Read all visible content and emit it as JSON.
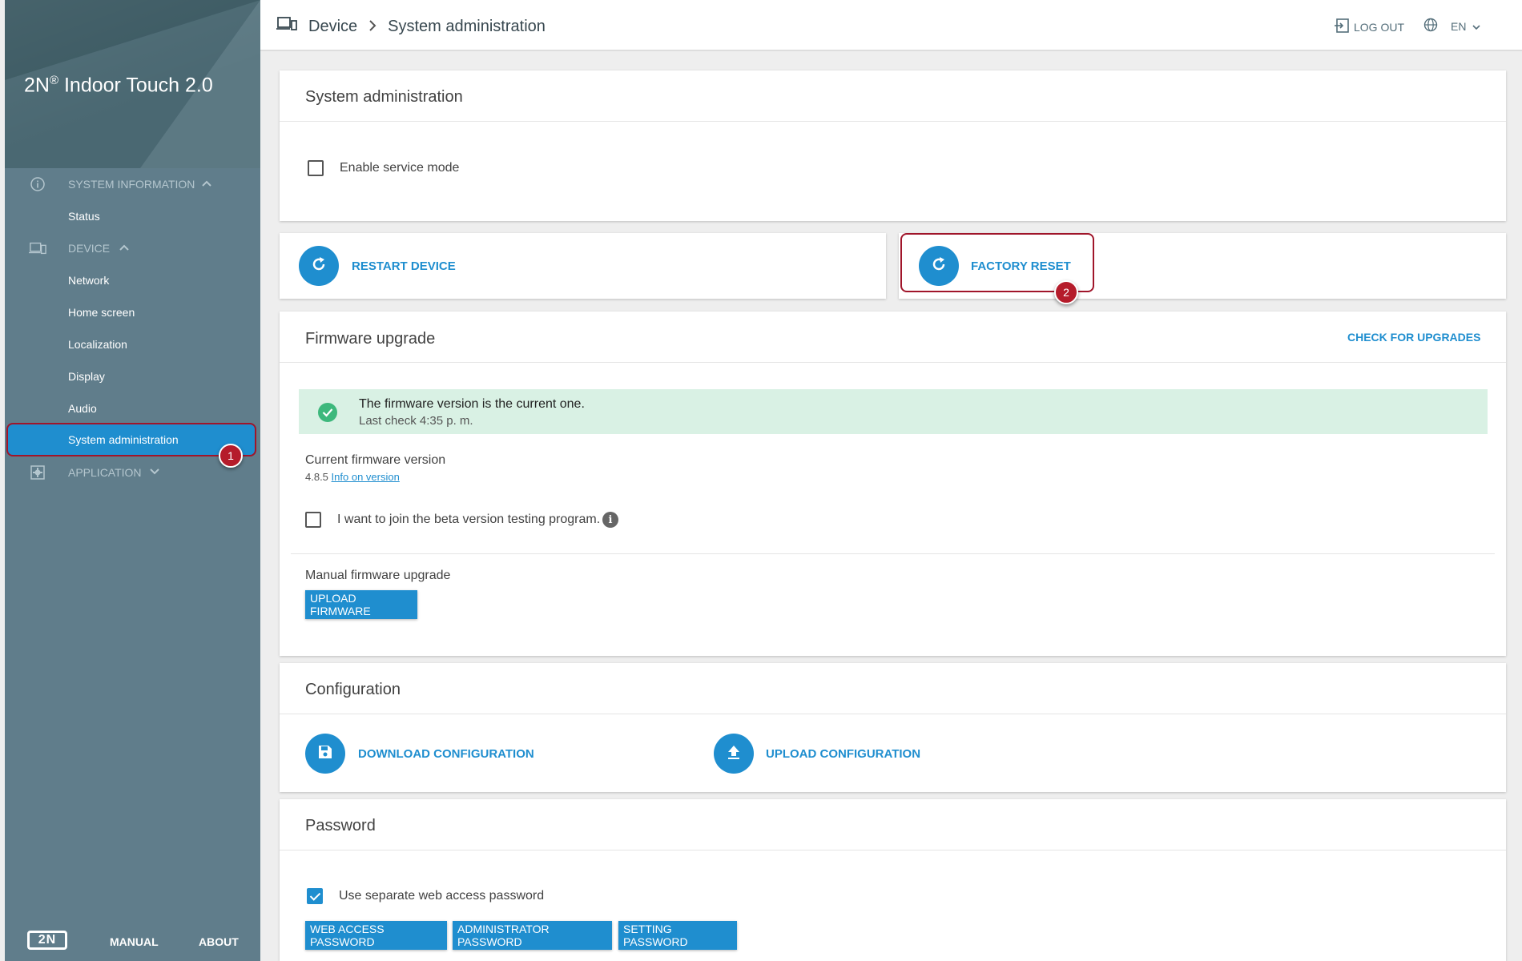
{
  "brand": {
    "name": "2N",
    "reg": "®",
    "product": " Indoor Touch 2.0"
  },
  "sidebar": {
    "sections": [
      {
        "label": "SYSTEM INFORMATION",
        "icon": "info-icon",
        "items": [
          "Status"
        ]
      },
      {
        "label": "DEVICE",
        "icon": "device-icon",
        "items": [
          "Network",
          "Home screen",
          "Localization",
          "Display",
          "Audio",
          "System administration"
        ]
      },
      {
        "label": "APPLICATION",
        "icon": "application-icon",
        "items": []
      }
    ],
    "active_item": "System administration",
    "footer": {
      "logo": "2N",
      "manual": "MANUAL",
      "about": "ABOUT"
    }
  },
  "topbar": {
    "breadcrumb": [
      "Device",
      "System administration"
    ],
    "logout": "LOG OUT",
    "language": "EN"
  },
  "annotations": {
    "badge1": "1",
    "badge2": "2"
  },
  "system_admin": {
    "title": "System administration",
    "service_mode_label": "Enable service mode",
    "service_mode_checked": false
  },
  "actions": {
    "restart": "RESTART DEVICE",
    "factory_reset": "FACTORY RESET"
  },
  "firmware": {
    "title": "Firmware upgrade",
    "check_upgrades": "CHECK FOR UPGRADES",
    "status_main": "The firmware version is the current one.",
    "status_sub": "Last check 4:35 p. m.",
    "current_label": "Current firmware version",
    "version": "4.8.5",
    "info_link": "Info on version",
    "beta_label": "I want to join the beta version testing program.",
    "beta_checked": false,
    "manual_label": "Manual firmware upgrade",
    "upload_button": "UPLOAD FIRMWARE"
  },
  "configuration": {
    "title": "Configuration",
    "download": "DOWNLOAD CONFIGURATION",
    "upload": "UPLOAD CONFIGURATION"
  },
  "password": {
    "title": "Password",
    "separate_label": "Use separate web access password",
    "separate_checked": true,
    "buttons": [
      "WEB ACCESS PASSWORD",
      "ADMINISTRATOR PASSWORD",
      "SETTING PASSWORD"
    ]
  },
  "colors": {
    "accent": "#1f8ecf",
    "sidebar": "#607d8b",
    "annotation": "#b51c2b",
    "success_bg": "#d9f1e4"
  }
}
